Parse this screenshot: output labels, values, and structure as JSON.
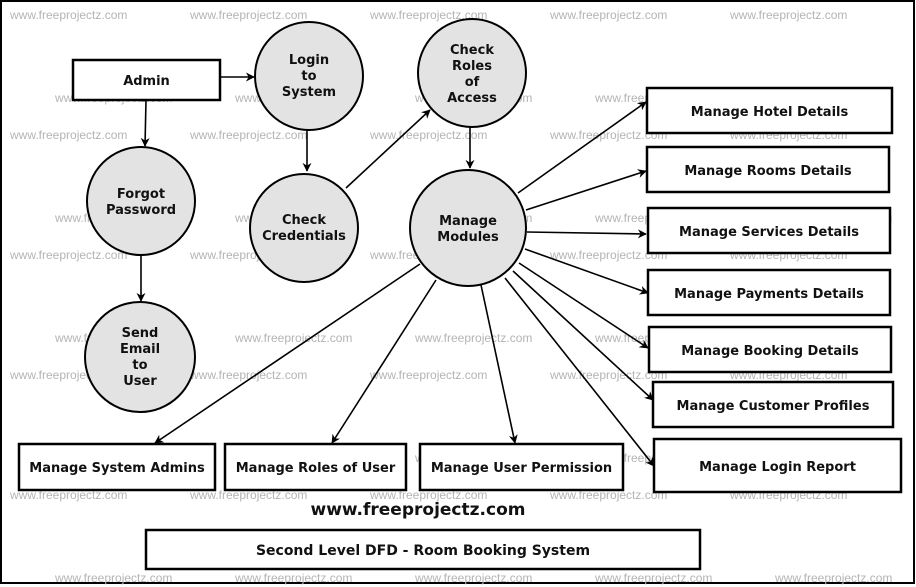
{
  "diagram": {
    "type": "data-flow-diagram",
    "level": "Second Level DFD",
    "title": "Second Level DFD - Room Booking System",
    "site": "www.freeprojectz.com",
    "watermark": "www.freeprojectz.com",
    "colors": {
      "process_fill": "#e3e3e3",
      "stroke": "#000000",
      "watermark": "#b4b4b4"
    },
    "entities": [
      {
        "id": "admin",
        "label": "Admin"
      }
    ],
    "processes": [
      {
        "id": "login",
        "lines": [
          "Login",
          "to",
          "System"
        ]
      },
      {
        "id": "roles",
        "lines": [
          "Check",
          "Roles",
          "of",
          "Access"
        ]
      },
      {
        "id": "forgot",
        "lines": [
          "Forgot",
          "Password"
        ]
      },
      {
        "id": "creds",
        "lines": [
          "Check",
          "Credentials"
        ]
      },
      {
        "id": "modules",
        "lines": [
          "Manage",
          "Modules"
        ]
      },
      {
        "id": "email",
        "lines": [
          "Send",
          "Email",
          "to",
          "User"
        ]
      }
    ],
    "modules": [
      {
        "id": "hotel",
        "label": "Manage Hotel Details"
      },
      {
        "id": "rooms",
        "label": "Manage Rooms Details"
      },
      {
        "id": "services",
        "label": "Manage Services Details"
      },
      {
        "id": "payments",
        "label": "Manage Payments Details"
      },
      {
        "id": "booking",
        "label": "Manage Booking Details"
      },
      {
        "id": "customers",
        "label": "Manage Customer Profiles"
      },
      {
        "id": "loginreport",
        "label": "Manage Login Report"
      },
      {
        "id": "sysadmins",
        "label": "Manage System Admins"
      },
      {
        "id": "userroles",
        "label": "Manage Roles of User"
      },
      {
        "id": "permission",
        "label": "Manage User Permission"
      }
    ],
    "flows": [
      {
        "from": "admin",
        "to": "login"
      },
      {
        "from": "admin",
        "to": "forgot"
      },
      {
        "from": "login",
        "to": "creds"
      },
      {
        "from": "creds",
        "to": "roles"
      },
      {
        "from": "roles",
        "to": "modules"
      },
      {
        "from": "forgot",
        "to": "email"
      },
      {
        "from": "modules",
        "to": "hotel"
      },
      {
        "from": "modules",
        "to": "rooms"
      },
      {
        "from": "modules",
        "to": "services"
      },
      {
        "from": "modules",
        "to": "payments"
      },
      {
        "from": "modules",
        "to": "booking"
      },
      {
        "from": "modules",
        "to": "customers"
      },
      {
        "from": "modules",
        "to": "loginreport"
      },
      {
        "from": "modules",
        "to": "sysadmins"
      },
      {
        "from": "modules",
        "to": "userroles"
      },
      {
        "from": "modules",
        "to": "permission"
      }
    ]
  }
}
